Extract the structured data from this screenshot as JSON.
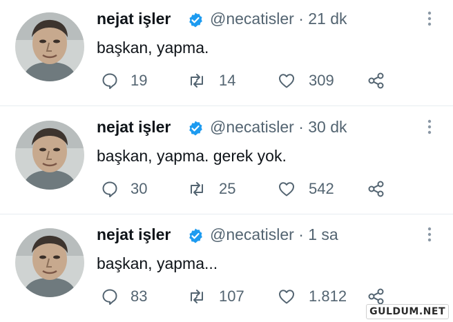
{
  "tweets": [
    {
      "display_name": "nejat işler",
      "handle": "@necatisler",
      "time": "· 21 dk",
      "text": "başkan, yapma.",
      "replies": "19",
      "retweets": "14",
      "likes": "309"
    },
    {
      "display_name": "nejat işler",
      "handle": "@necatisler",
      "time": "· 30 dk",
      "text": "başkan, yapma. gerek yok.",
      "replies": "30",
      "retweets": "25",
      "likes": "542"
    },
    {
      "display_name": "nejat işler",
      "handle": "@necatisler",
      "time": "· 1 sa",
      "text": "başkan, yapma...",
      "replies": "83",
      "retweets": "107",
      "likes": "1.812"
    }
  ],
  "watermark": "GULDUM.NET",
  "colors": {
    "verified": "#1d9bf0",
    "secondary_text": "#536471",
    "primary_text": "#0f1419"
  },
  "icons": [
    "verified-badge-icon",
    "more-options-icon",
    "reply-icon",
    "retweet-icon",
    "like-icon",
    "share-icon"
  ]
}
